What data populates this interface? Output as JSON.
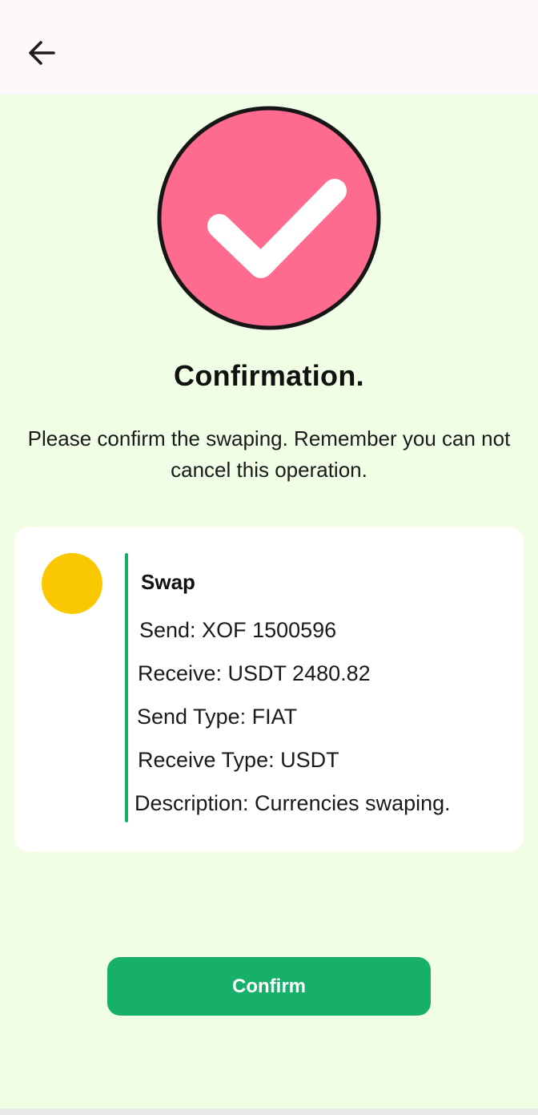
{
  "header": {
    "back_icon": "arrow-left-icon"
  },
  "status": {
    "icon": "check-circle-icon",
    "title": "Confirmation.",
    "message": "Please confirm the swaping. Remember you can not cancel this operation."
  },
  "card": {
    "coin_icon": "coin-icon",
    "title": "Swap",
    "rows": [
      "Send: XOF 1500596",
      "Receive: USDT 2480.82",
      "Send Type: FIAT",
      "Receive Type: USDT",
      "Description: Currencies swaping."
    ]
  },
  "actions": {
    "confirm_label": "Confirm"
  },
  "colors": {
    "accent": "#16b06a",
    "check_fill": "#ff6b8e",
    "coin": "#f9c800",
    "background": "#f0fee6",
    "topbar": "#fef8fc"
  }
}
